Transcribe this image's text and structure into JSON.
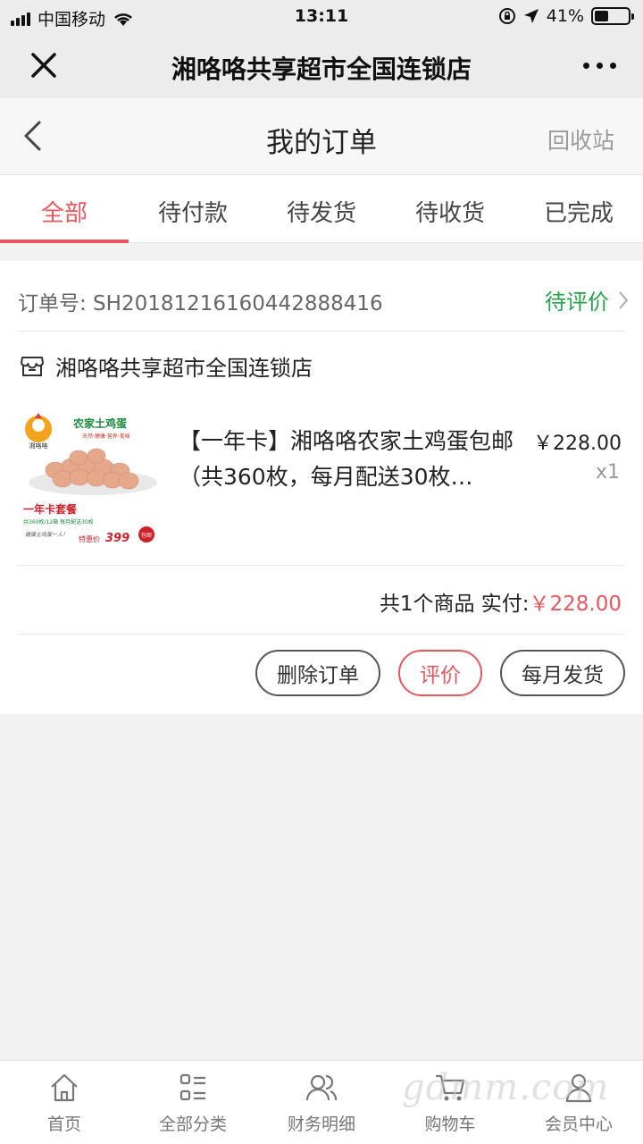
{
  "status_bar": {
    "carrier": "中国移动",
    "time": "13:11",
    "battery": "41%",
    "battery_level": 0.41
  },
  "app_bar": {
    "title": "湘咯咯共享超市全国连锁店"
  },
  "page_header": {
    "title": "我的订单",
    "recycle_label": "回收站"
  },
  "tabs": [
    {
      "label": "全部",
      "active": true
    },
    {
      "label": "待付款",
      "active": false
    },
    {
      "label": "待发货",
      "active": false
    },
    {
      "label": "待收货",
      "active": false
    },
    {
      "label": "已完成",
      "active": false
    }
  ],
  "order": {
    "order_no_label": "订单号: SH20181216160442888416",
    "status": "待评价",
    "store_name": "湘咯咯共享超市全国连锁店",
    "product": {
      "name": "【一年卡】湘咯咯农家土鸡蛋包邮（共360枚，每月配送30枚…",
      "price": "￥228.00",
      "qty": "x1",
      "image": {
        "brand": "湘咯咯",
        "title": "农家土鸡蛋",
        "tagline": "天然·健康·营养·美味",
        "package": "一年卡套餐",
        "detail": "共360枚/12箱  每月配送30枚",
        "note": "健康土鸡蛋一人！",
        "promo_label": "特惠价",
        "promo_price": "399",
        "badge": "包邮"
      }
    },
    "total_label": "共1个商品 实付:",
    "total_amount": "￥228.00",
    "buttons": {
      "delete": "删除订单",
      "review": "评价",
      "monthly": "每月发货"
    }
  },
  "bottom_nav": [
    {
      "label": "首页",
      "icon": "home-icon"
    },
    {
      "label": "全部分类",
      "icon": "category-icon"
    },
    {
      "label": "财务明细",
      "icon": "users-icon"
    },
    {
      "label": "购物车",
      "icon": "cart-icon"
    },
    {
      "label": "会员中心",
      "icon": "member-icon"
    }
  ],
  "watermark": "gdmm.com",
  "colors": {
    "accent": "#e8575d",
    "status_green": "#27a24a"
  }
}
